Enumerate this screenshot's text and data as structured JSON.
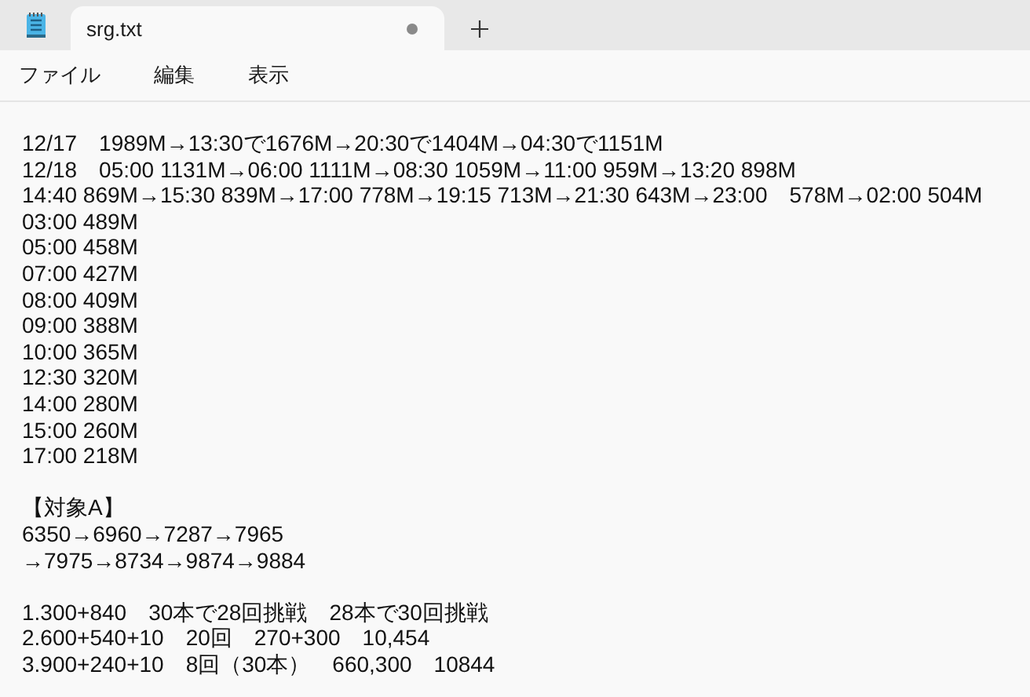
{
  "tab": {
    "title": "srg.txt",
    "unsaved": true,
    "selected": true
  },
  "menu": [
    "ファイル",
    "編集",
    "表示"
  ],
  "paragraphs": [
    [
      "12/17　1989M→13:30で1676M→20:30で1404M→04:30で1151M",
      "12/18　05:00 1131M→06:00 1111M→08:30 1059M→11:00 959M→13:20 898M",
      "14:40 869M→15:30 839M→17:00 778M→19:15 713M→21:30 643M→23:00　578M→02:00 504M",
      "03:00 489M",
      "05:00 458M",
      "07:00 427M",
      "08:00 409M",
      "09:00 388M",
      "10:00 365M",
      "12:30 320M",
      "14:00 280M",
      "15:00 260M",
      "17:00 218M"
    ],
    [
      "【対象A】",
      "6350→6960→7287→7965",
      "→7975→8734→9874→9884"
    ],
    [
      "1.300+840　30本で28回挑戦　28本で30回挑戦",
      "2.600+540+10　20回　270+300　10,454",
      "3.900+240+10　8回（30本）　660,300　10844"
    ]
  ]
}
